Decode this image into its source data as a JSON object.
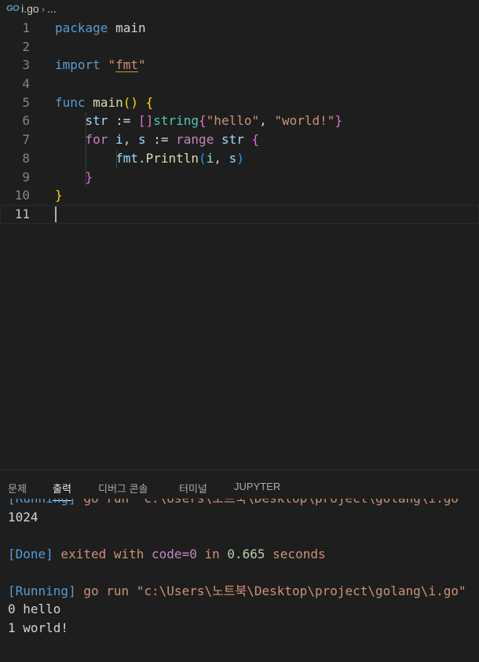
{
  "breadcrumb": {
    "icon": "GO",
    "file": "i.go",
    "ellipsis": "..."
  },
  "editor": {
    "lines": [
      {
        "n": "1",
        "tokens": [
          [
            "k",
            "package"
          ],
          [
            "p",
            " main"
          ]
        ]
      },
      {
        "n": "2",
        "tokens": []
      },
      {
        "n": "3",
        "tokens": [
          [
            "k",
            "import"
          ],
          [
            "p",
            " "
          ],
          [
            "s",
            "\""
          ],
          [
            "s_under",
            "fmt"
          ],
          [
            "s",
            "\""
          ]
        ]
      },
      {
        "n": "4",
        "tokens": []
      },
      {
        "n": "5",
        "tokens": [
          [
            "k",
            "func"
          ],
          [
            "p",
            " "
          ],
          [
            "f",
            "main"
          ],
          [
            "b1",
            "()"
          ],
          [
            "p",
            " "
          ],
          [
            "b1",
            "{"
          ]
        ]
      },
      {
        "n": "6",
        "tokens": [
          [
            "p",
            "    "
          ],
          [
            "v",
            "str"
          ],
          [
            "p",
            " := "
          ],
          [
            "b2",
            "[]"
          ],
          [
            "t",
            "string"
          ],
          [
            "b2",
            "{"
          ],
          [
            "s",
            "\"hello\""
          ],
          [
            "p",
            ", "
          ],
          [
            "s",
            "\"world!\""
          ],
          [
            "b2",
            "}"
          ]
        ]
      },
      {
        "n": "7",
        "tokens": [
          [
            "p",
            "    "
          ],
          [
            "c",
            "for"
          ],
          [
            "p",
            " "
          ],
          [
            "v",
            "i"
          ],
          [
            "p",
            ", "
          ],
          [
            "v",
            "s"
          ],
          [
            "p",
            " := "
          ],
          [
            "c",
            "range"
          ],
          [
            "p",
            " "
          ],
          [
            "v",
            "str"
          ],
          [
            "p",
            " "
          ],
          [
            "b2",
            "{"
          ]
        ]
      },
      {
        "n": "8",
        "tokens": [
          [
            "p",
            "        "
          ],
          [
            "v",
            "fmt"
          ],
          [
            "p",
            "."
          ],
          [
            "f",
            "Println"
          ],
          [
            "b3",
            "("
          ],
          [
            "v",
            "i"
          ],
          [
            "p",
            ", "
          ],
          [
            "v",
            "s"
          ],
          [
            "b3",
            ")"
          ]
        ]
      },
      {
        "n": "9",
        "tokens": [
          [
            "p",
            "    "
          ],
          [
            "b2",
            "}"
          ]
        ]
      },
      {
        "n": "10",
        "tokens": [
          [
            "b1",
            "}"
          ]
        ]
      },
      {
        "n": "11",
        "tokens": [],
        "active": true
      }
    ]
  },
  "panel": {
    "tabs": [
      {
        "label": "문제",
        "active": false
      },
      {
        "label": "출력",
        "active": true
      },
      {
        "label": "디버그 콘솔",
        "active": false
      },
      {
        "label": "터미널",
        "active": false
      },
      {
        "label": "JUPYTER",
        "active": false
      }
    ],
    "output": [
      {
        "parts": [
          [
            "out-blue",
            "[Running]"
          ],
          [
            "out-or",
            " go run \"c:\\Users\\노트북\\Desktop\\project\\golang\\i.go\""
          ]
        ],
        "partial": true
      },
      {
        "parts": [
          [
            "out-txt",
            "1024"
          ]
        ]
      },
      {
        "parts": []
      },
      {
        "parts": [
          [
            "out-blue",
            "[Done]"
          ],
          [
            "out-or",
            " exited with "
          ],
          [
            "out-code",
            "code=0"
          ],
          [
            "out-or",
            " in "
          ],
          [
            "out-num",
            "0.665"
          ],
          [
            "out-or",
            " seconds"
          ]
        ]
      },
      {
        "parts": []
      },
      {
        "parts": [
          [
            "out-blue",
            "[Running]"
          ],
          [
            "out-or",
            " go run \"c:\\Users\\노트북\\Desktop\\project\\golang\\i.go\""
          ]
        ]
      },
      {
        "parts": [
          [
            "out-txt",
            "0 hello"
          ]
        ]
      },
      {
        "parts": [
          [
            "out-txt",
            "1 world!"
          ]
        ]
      }
    ]
  }
}
